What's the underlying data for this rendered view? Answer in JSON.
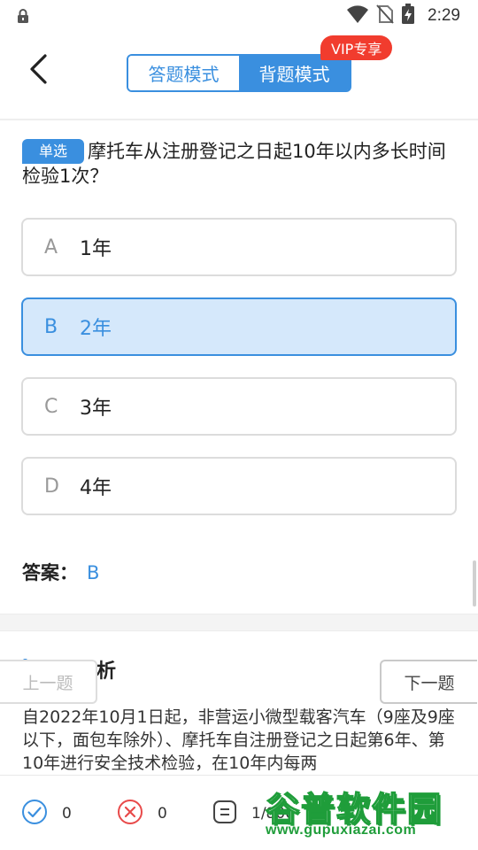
{
  "status_bar": {
    "time": "2:29",
    "icons": [
      "lock-icon",
      "wifi-icon",
      "no-sim-icon",
      "battery-charging-icon"
    ]
  },
  "header": {
    "back_icon": "chevron-left-icon",
    "tabs": [
      {
        "label": "答题模式",
        "active": false
      },
      {
        "label": "背题模式",
        "active": true
      }
    ],
    "vip_badge": "VIP专享"
  },
  "question": {
    "type_tag": "单选",
    "text": "摩托车从注册登记之日起10年以内多长时间检验1次？",
    "options": [
      {
        "letter": "A",
        "text": "1年",
        "selected": false
      },
      {
        "letter": "B",
        "text": "2年",
        "selected": true
      },
      {
        "letter": "C",
        "text": "3年",
        "selected": false
      },
      {
        "letter": "D",
        "text": "4年",
        "selected": false
      }
    ],
    "answer_label": "答案：",
    "answer_value": "B"
  },
  "analysis": {
    "title": "题目解析",
    "text": "自2022年10月1日起，非营运小微型载客汽车（9座及9座以下，面包车除外）、摩托车自注册登记之日起第6年、第10年进行安全技术检验，在10年内每两"
  },
  "navigation": {
    "prev_label": "上一题",
    "next_label": "下一题"
  },
  "bottom_bar": {
    "correct_count": "0",
    "wrong_count": "0",
    "progress": "1/800"
  },
  "watermark": {
    "title": "谷普软件园",
    "url": "www.gupuxiazai.com"
  },
  "colors": {
    "accent": "#3a8fdf",
    "selected_bg": "#d5e8fb",
    "vip_red": "#f13c2e",
    "error_red": "#e84a4a",
    "watermark_green": "#1f9d3a"
  }
}
